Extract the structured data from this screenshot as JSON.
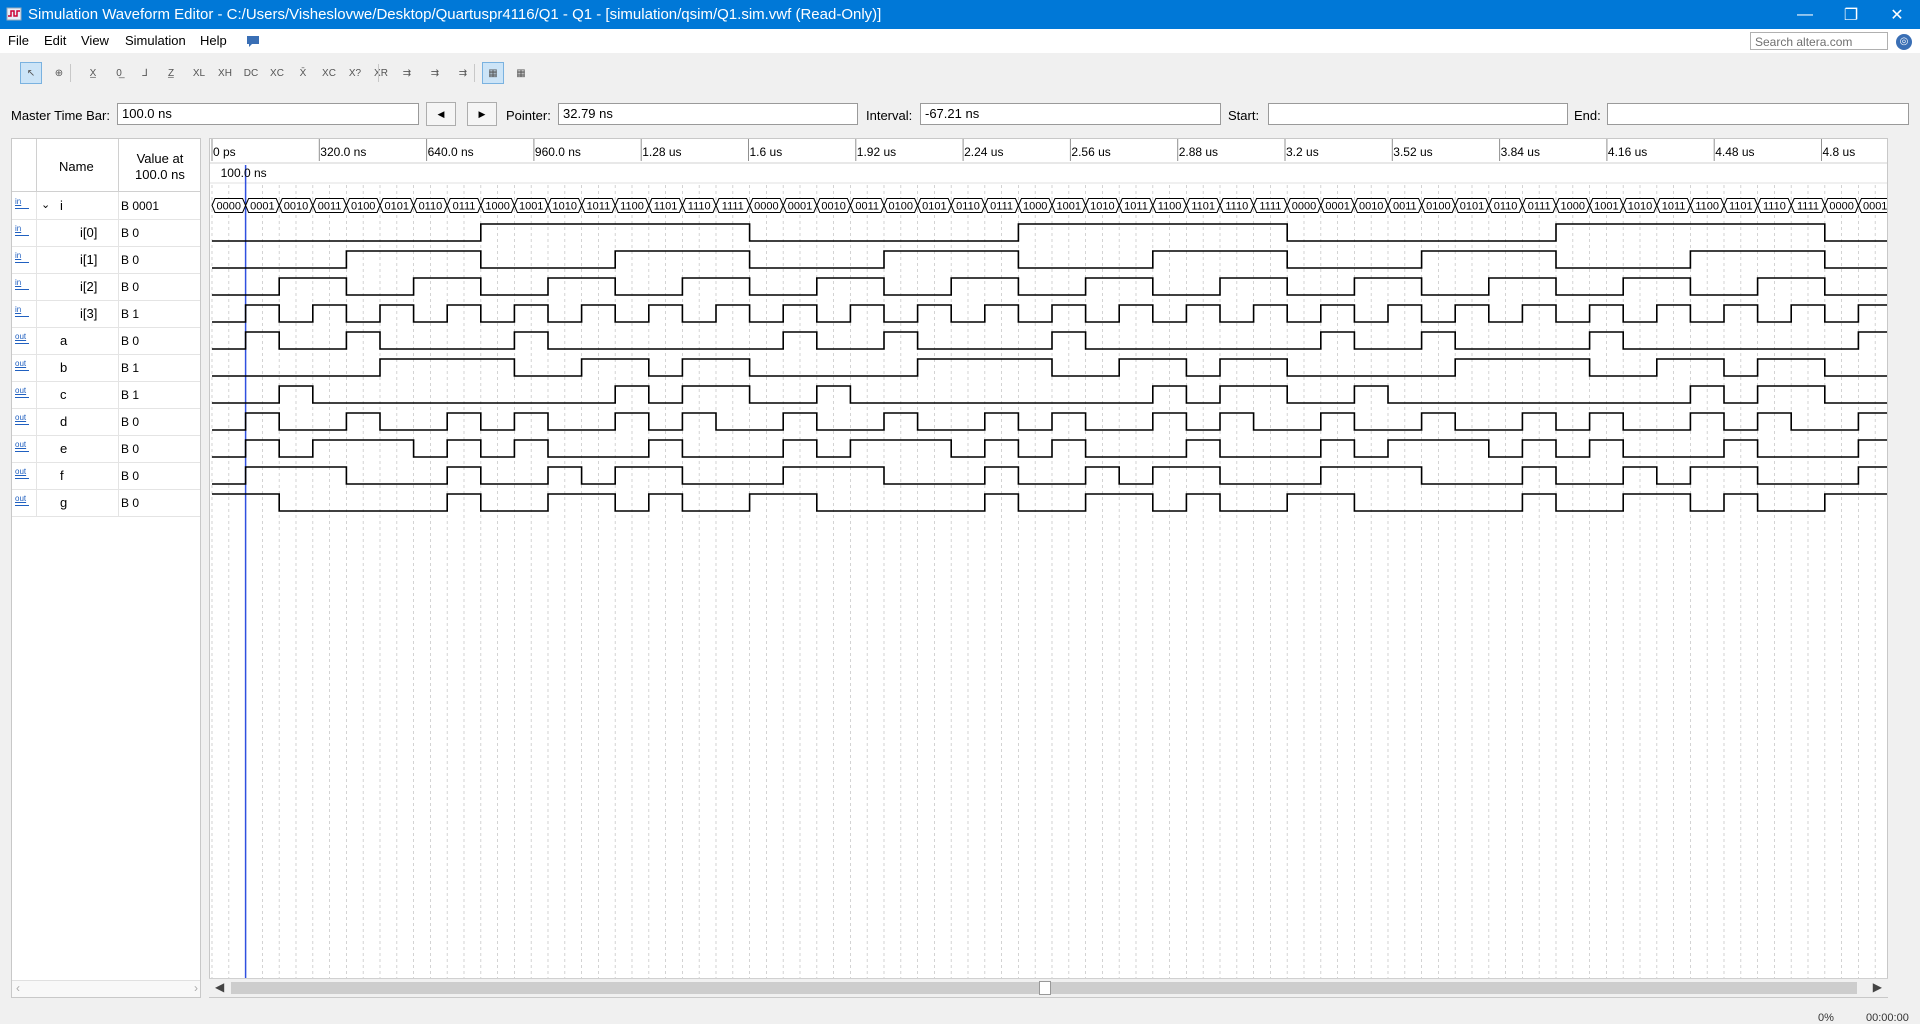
{
  "window": {
    "title": "Simulation Waveform Editor - C:/Users/Visheslovwe/Desktop/Quartuspr4116/Q1 - Q1 - [simulation/qsim/Q1.sim.vwf (Read-Only)]",
    "minimize": "—",
    "restore": "❐",
    "close": "✕"
  },
  "menu": {
    "file": "File",
    "edit": "Edit",
    "view": "View",
    "simulation": "Simulation",
    "help": "Help"
  },
  "search": {
    "placeholder": "Search altera.com"
  },
  "toolbar": {
    "icons": [
      "selection-tool-icon",
      "zoom-tool-icon",
      "forcing-unknown-icon",
      "forcing-low-icon",
      "forcing-high-icon",
      "high-impedance-icon",
      "weak-low-icon",
      "weak-high-icon",
      "dont-care-icon",
      "invert-icon",
      "count-value-icon",
      "clock-icon",
      "arbitrary-value-icon",
      "random-value-icon",
      "run-functional-simulation-icon",
      "run-timing-simulation-icon",
      "generate-netlist-icon",
      "snap-to-grid-icon",
      "grouping-icon"
    ]
  },
  "timebar": {
    "master_label": "Master Time Bar:",
    "master_value": "100.0 ns",
    "pointer_label": "Pointer:",
    "pointer_value": "32.79 ns",
    "interval_label": "Interval:",
    "interval_value": "-67.21 ns",
    "start_label": "Start:",
    "start_value": "",
    "end_label": "End:",
    "end_value": ""
  },
  "list": {
    "name_header": "Name",
    "value_header_line1": "Value at",
    "value_header_line2": "100.0 ns",
    "signals": [
      {
        "name": "i",
        "value": "B 0001",
        "dir": "in",
        "group": true
      },
      {
        "name": "i[0]",
        "value": "B 0",
        "dir": "in"
      },
      {
        "name": "i[1]",
        "value": "B 0",
        "dir": "in"
      },
      {
        "name": "i[2]",
        "value": "B 0",
        "dir": "in"
      },
      {
        "name": "i[3]",
        "value": "B 1",
        "dir": "in"
      },
      {
        "name": "a",
        "value": "B 0",
        "dir": "out"
      },
      {
        "name": "b",
        "value": "B 1",
        "dir": "out"
      },
      {
        "name": "c",
        "value": "B 1",
        "dir": "out"
      },
      {
        "name": "d",
        "value": "B 0",
        "dir": "out"
      },
      {
        "name": "e",
        "value": "B 0",
        "dir": "out"
      },
      {
        "name": "f",
        "value": "B 0",
        "dir": "out"
      },
      {
        "name": "g",
        "value": "B 0",
        "dir": "out"
      }
    ]
  },
  "ruler": {
    "ticks": [
      "0 ps",
      "320.0 ns",
      "640.0 ns",
      "960.0 ns",
      "1.28 us",
      "1.6 us",
      "1.92 us",
      "2.24 us",
      "2.56 us",
      "2.88 us",
      "3.2 us",
      "3.52 us",
      "3.84 us",
      "4.16 us",
      "4.48 us",
      "4.8 us"
    ],
    "marker_label": "100.0 ns"
  },
  "waves": {
    "bus_values": [
      "0000",
      "0001",
      "0010",
      "0011",
      "0100",
      "0101",
      "0110",
      "0111",
      "1000",
      "1001",
      "1010",
      "1011",
      "1100",
      "1101",
      "1110",
      "1111",
      "0000",
      "0001",
      "0010",
      "0011",
      "0100",
      "0101",
      "0110",
      "0111",
      "1000",
      "1001",
      "1010",
      "1011",
      "1100",
      "1101",
      "1110",
      "1111",
      "0000",
      "0001",
      "0010",
      "0011",
      "0100",
      "0101",
      "0110",
      "0111",
      "1000",
      "1001",
      "1010",
      "1011",
      "1100",
      "1101",
      "1110",
      "1111",
      "0000",
      "0001"
    ],
    "rows": [
      "00000000111111110000000011111111000000001111111100",
      "00001111000011110000111100001111000011110000111100",
      "00110011001100110011001100110011001100110011001100",
      "01010101010101010101010101010101010101010101010101",
      "01001000010000000100100001000000010010000100000001",
      "00000111100110110000011110011011000001111001101100",
      "00100000000010110010000000001011001000000000101100",
      "01001001010010100100100101001010010010010100101001",
      "01011101010001000101110101000100010111010100010001",
      "01110001001011000111000100101100011100010010110001",
      "11000001001101001100000100110100110000010011010011"
    ]
  },
  "status": {
    "percent": "0%",
    "time": "00:00:00"
  }
}
